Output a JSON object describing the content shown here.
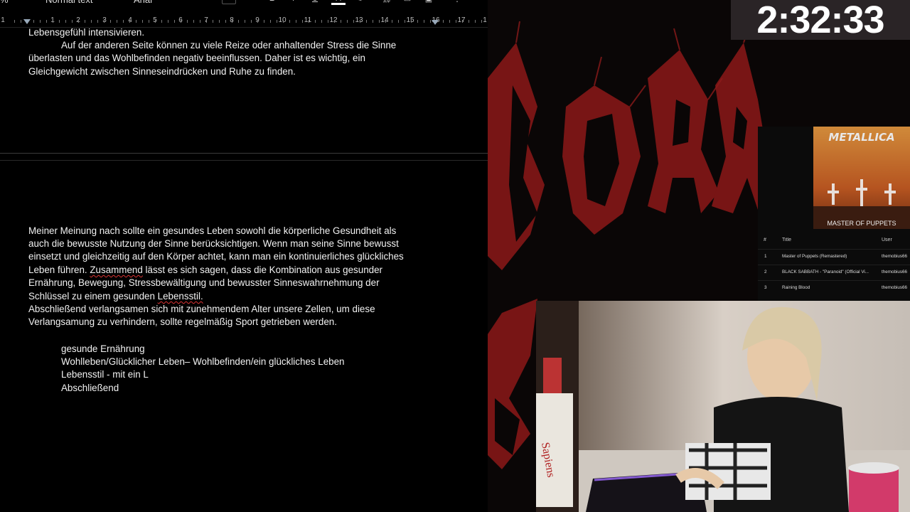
{
  "toolbar": {
    "zoom": "%",
    "style": "Normal text",
    "font": "Arial"
  },
  "ruler": {
    "ticks": [
      "1",
      "1",
      "2",
      "3",
      "4",
      "5",
      "6",
      "7",
      "8",
      "9",
      "10",
      "11",
      "12",
      "13",
      "14",
      "15",
      "16",
      "17",
      "1"
    ]
  },
  "document": {
    "lines_top": [
      "Lebensgefühl intensivieren.",
      "Auf der anderen Seite können zu viele Reize oder anhaltender Stress die Sinne",
      "überlasten und das Wohlbefinden negativ beeinflussen. Daher ist es wichtig, ein",
      "Gleichgewicht zwischen Sinneseindrücken und Ruhe zu finden."
    ],
    "para": {
      "l1": "Meiner Meinung nach sollte ein gesundes Leben sowohl die körperliche Gesundheit als",
      "l2": "auch die bewusste Nutzung der Sinne berücksichtigen. Wenn man seine Sinne bewusst",
      "l3": "einsetzt und gleichzeitig auf den Körper achtet, kann man ein kontinuierliches glückliches",
      "l4_a": "Leben führen. ",
      "l4_b": "Zusammend",
      "l4_c": " lässt es sich sagen, dass die Kombination aus gesunder",
      "l5": "Ernährung, Bewegung, Stressbewältigung und bewusster Sinneswahrnehmung der",
      "l6_a": "Schlüssel zu einem gesunden ",
      "l6_b": "Lebensstil.",
      "l7": "Abschließend verlangsamen sich mit zunehmendem Alter unsere Zellen, um diese",
      "l8": "Verlangsamung zu verhindern, sollte regelmäßig Sport getrieben werden."
    },
    "notes": [
      "gesunde Ernährung",
      "Wohlleben/Glücklicher Leben– Wohlbefinden/ein glückliches Leben",
      "Lebensstil - mit ein L",
      "Abschließend"
    ]
  },
  "stream": {
    "timer": "2:32:33",
    "album": {
      "band": "METALLICA",
      "title": "MASTER OF PUPPETS"
    },
    "playlist": {
      "headers": [
        "#",
        "Title",
        "User"
      ],
      "rows": [
        {
          "num": "1",
          "title": "Master of Puppets (Remastered)",
          "user": "themobius66"
        },
        {
          "num": "2",
          "title": "BLACK SABBATH - \"Paranoid\" (Official Vi...",
          "user": "themobius66"
        },
        {
          "num": "3",
          "title": "Raining Blood",
          "user": "themobius66"
        }
      ]
    },
    "colors": {
      "accent_red": "#8b1a1a",
      "timer_bg": "#2a2426"
    }
  }
}
